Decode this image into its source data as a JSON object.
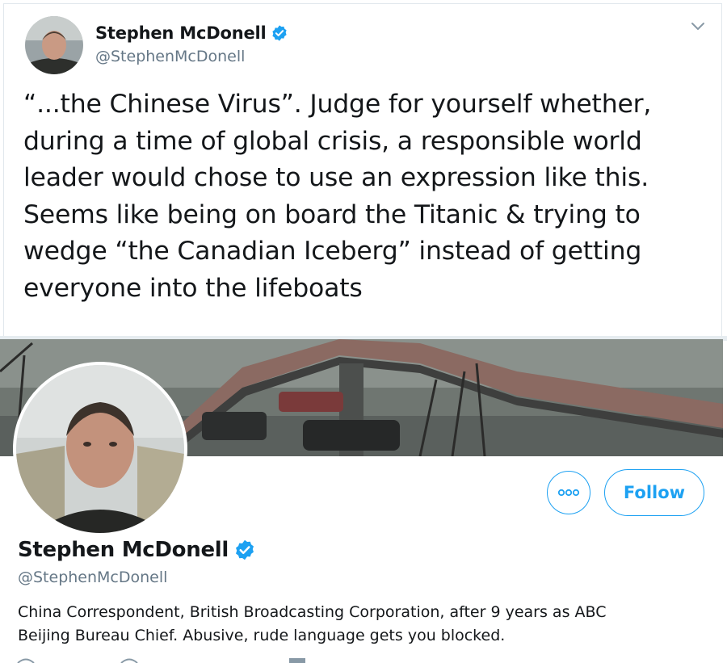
{
  "tweet": {
    "author_name": "Stephen McDonell",
    "author_handle": "@StephenMcDonell",
    "text_lines": [
      "“...the Chinese Virus”. Judge for yourself whether,",
      "during a time of global crisis, a responsible world",
      "leader would chose to use an expression like this.",
      "Seems like being on board the Titanic & trying to",
      "wedge “the Canadian Iceberg” instead of getting",
      "everyone into the lifeboats"
    ]
  },
  "profile": {
    "name": "Stephen McDonell",
    "handle": "@StephenMcDonell",
    "follow_label": "Follow",
    "bio_lines": [
      "China Correspondent, British Broadcasting Corporation, after 9 years as ABC",
      "Beijing Bureau Chief. Abusive, rude language gets you blocked."
    ]
  },
  "colors": {
    "accent": "#1da1f2",
    "secondary_text": "#657786",
    "border": "#e1e8ed"
  },
  "icons": {
    "verified": "verified-badge-icon",
    "caret": "chevron-down-icon",
    "more": "more-options-icon"
  }
}
